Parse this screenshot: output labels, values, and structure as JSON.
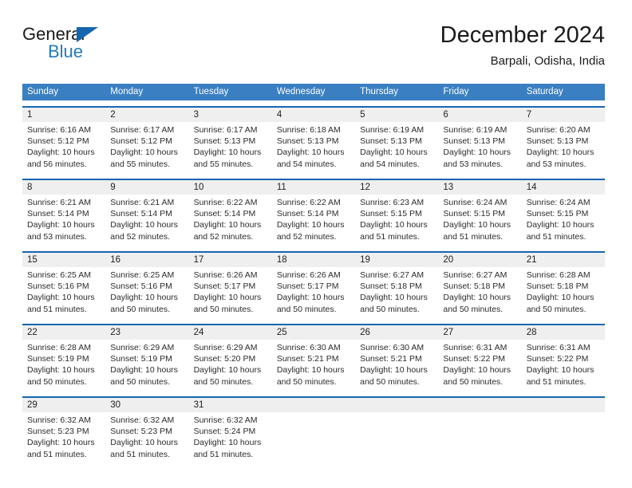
{
  "brand": {
    "name_top": "General",
    "name_bottom": "Blue",
    "accent_color": "#1f7ac0",
    "triangle_color": "#1566b0"
  },
  "header": {
    "title": "December 2024",
    "subtitle": "Barpali, Odisha, India"
  },
  "calendar": {
    "header_bg": "#3a7fc1",
    "row_border_color": "#1566b0",
    "number_band_bg": "#efefef",
    "day_names": [
      "Sunday",
      "Monday",
      "Tuesday",
      "Wednesday",
      "Thursday",
      "Friday",
      "Saturday"
    ],
    "weeks": [
      {
        "numbers": [
          "1",
          "2",
          "3",
          "4",
          "5",
          "6",
          "7"
        ],
        "days": [
          {
            "sunrise": "Sunrise: 6:16 AM",
            "sunset": "Sunset: 5:12 PM",
            "daylight_1": "Daylight: 10 hours",
            "daylight_2": "and 56 minutes."
          },
          {
            "sunrise": "Sunrise: 6:17 AM",
            "sunset": "Sunset: 5:12 PM",
            "daylight_1": "Daylight: 10 hours",
            "daylight_2": "and 55 minutes."
          },
          {
            "sunrise": "Sunrise: 6:17 AM",
            "sunset": "Sunset: 5:13 PM",
            "daylight_1": "Daylight: 10 hours",
            "daylight_2": "and 55 minutes."
          },
          {
            "sunrise": "Sunrise: 6:18 AM",
            "sunset": "Sunset: 5:13 PM",
            "daylight_1": "Daylight: 10 hours",
            "daylight_2": "and 54 minutes."
          },
          {
            "sunrise": "Sunrise: 6:19 AM",
            "sunset": "Sunset: 5:13 PM",
            "daylight_1": "Daylight: 10 hours",
            "daylight_2": "and 54 minutes."
          },
          {
            "sunrise": "Sunrise: 6:19 AM",
            "sunset": "Sunset: 5:13 PM",
            "daylight_1": "Daylight: 10 hours",
            "daylight_2": "and 53 minutes."
          },
          {
            "sunrise": "Sunrise: 6:20 AM",
            "sunset": "Sunset: 5:13 PM",
            "daylight_1": "Daylight: 10 hours",
            "daylight_2": "and 53 minutes."
          }
        ]
      },
      {
        "numbers": [
          "8",
          "9",
          "10",
          "11",
          "12",
          "13",
          "14"
        ],
        "days": [
          {
            "sunrise": "Sunrise: 6:21 AM",
            "sunset": "Sunset: 5:14 PM",
            "daylight_1": "Daylight: 10 hours",
            "daylight_2": "and 53 minutes."
          },
          {
            "sunrise": "Sunrise: 6:21 AM",
            "sunset": "Sunset: 5:14 PM",
            "daylight_1": "Daylight: 10 hours",
            "daylight_2": "and 52 minutes."
          },
          {
            "sunrise": "Sunrise: 6:22 AM",
            "sunset": "Sunset: 5:14 PM",
            "daylight_1": "Daylight: 10 hours",
            "daylight_2": "and 52 minutes."
          },
          {
            "sunrise": "Sunrise: 6:22 AM",
            "sunset": "Sunset: 5:14 PM",
            "daylight_1": "Daylight: 10 hours",
            "daylight_2": "and 52 minutes."
          },
          {
            "sunrise": "Sunrise: 6:23 AM",
            "sunset": "Sunset: 5:15 PM",
            "daylight_1": "Daylight: 10 hours",
            "daylight_2": "and 51 minutes."
          },
          {
            "sunrise": "Sunrise: 6:24 AM",
            "sunset": "Sunset: 5:15 PM",
            "daylight_1": "Daylight: 10 hours",
            "daylight_2": "and 51 minutes."
          },
          {
            "sunrise": "Sunrise: 6:24 AM",
            "sunset": "Sunset: 5:15 PM",
            "daylight_1": "Daylight: 10 hours",
            "daylight_2": "and 51 minutes."
          }
        ]
      },
      {
        "numbers": [
          "15",
          "16",
          "17",
          "18",
          "19",
          "20",
          "21"
        ],
        "days": [
          {
            "sunrise": "Sunrise: 6:25 AM",
            "sunset": "Sunset: 5:16 PM",
            "daylight_1": "Daylight: 10 hours",
            "daylight_2": "and 51 minutes."
          },
          {
            "sunrise": "Sunrise: 6:25 AM",
            "sunset": "Sunset: 5:16 PM",
            "daylight_1": "Daylight: 10 hours",
            "daylight_2": "and 50 minutes."
          },
          {
            "sunrise": "Sunrise: 6:26 AM",
            "sunset": "Sunset: 5:17 PM",
            "daylight_1": "Daylight: 10 hours",
            "daylight_2": "and 50 minutes."
          },
          {
            "sunrise": "Sunrise: 6:26 AM",
            "sunset": "Sunset: 5:17 PM",
            "daylight_1": "Daylight: 10 hours",
            "daylight_2": "and 50 minutes."
          },
          {
            "sunrise": "Sunrise: 6:27 AM",
            "sunset": "Sunset: 5:18 PM",
            "daylight_1": "Daylight: 10 hours",
            "daylight_2": "and 50 minutes."
          },
          {
            "sunrise": "Sunrise: 6:27 AM",
            "sunset": "Sunset: 5:18 PM",
            "daylight_1": "Daylight: 10 hours",
            "daylight_2": "and 50 minutes."
          },
          {
            "sunrise": "Sunrise: 6:28 AM",
            "sunset": "Sunset: 5:18 PM",
            "daylight_1": "Daylight: 10 hours",
            "daylight_2": "and 50 minutes."
          }
        ]
      },
      {
        "numbers": [
          "22",
          "23",
          "24",
          "25",
          "26",
          "27",
          "28"
        ],
        "days": [
          {
            "sunrise": "Sunrise: 6:28 AM",
            "sunset": "Sunset: 5:19 PM",
            "daylight_1": "Daylight: 10 hours",
            "daylight_2": "and 50 minutes."
          },
          {
            "sunrise": "Sunrise: 6:29 AM",
            "sunset": "Sunset: 5:19 PM",
            "daylight_1": "Daylight: 10 hours",
            "daylight_2": "and 50 minutes."
          },
          {
            "sunrise": "Sunrise: 6:29 AM",
            "sunset": "Sunset: 5:20 PM",
            "daylight_1": "Daylight: 10 hours",
            "daylight_2": "and 50 minutes."
          },
          {
            "sunrise": "Sunrise: 6:30 AM",
            "sunset": "Sunset: 5:21 PM",
            "daylight_1": "Daylight: 10 hours",
            "daylight_2": "and 50 minutes."
          },
          {
            "sunrise": "Sunrise: 6:30 AM",
            "sunset": "Sunset: 5:21 PM",
            "daylight_1": "Daylight: 10 hours",
            "daylight_2": "and 50 minutes."
          },
          {
            "sunrise": "Sunrise: 6:31 AM",
            "sunset": "Sunset: 5:22 PM",
            "daylight_1": "Daylight: 10 hours",
            "daylight_2": "and 50 minutes."
          },
          {
            "sunrise": "Sunrise: 6:31 AM",
            "sunset": "Sunset: 5:22 PM",
            "daylight_1": "Daylight: 10 hours",
            "daylight_2": "and 51 minutes."
          }
        ]
      },
      {
        "numbers": [
          "29",
          "30",
          "31",
          "",
          "",
          "",
          ""
        ],
        "days": [
          {
            "sunrise": "Sunrise: 6:32 AM",
            "sunset": "Sunset: 5:23 PM",
            "daylight_1": "Daylight: 10 hours",
            "daylight_2": "and 51 minutes."
          },
          {
            "sunrise": "Sunrise: 6:32 AM",
            "sunset": "Sunset: 5:23 PM",
            "daylight_1": "Daylight: 10 hours",
            "daylight_2": "and 51 minutes."
          },
          {
            "sunrise": "Sunrise: 6:32 AM",
            "sunset": "Sunset: 5:24 PM",
            "daylight_1": "Daylight: 10 hours",
            "daylight_2": "and 51 minutes."
          },
          {
            "sunrise": "",
            "sunset": "",
            "daylight_1": "",
            "daylight_2": ""
          },
          {
            "sunrise": "",
            "sunset": "",
            "daylight_1": "",
            "daylight_2": ""
          },
          {
            "sunrise": "",
            "sunset": "",
            "daylight_1": "",
            "daylight_2": ""
          },
          {
            "sunrise": "",
            "sunset": "",
            "daylight_1": "",
            "daylight_2": ""
          }
        ]
      }
    ]
  }
}
